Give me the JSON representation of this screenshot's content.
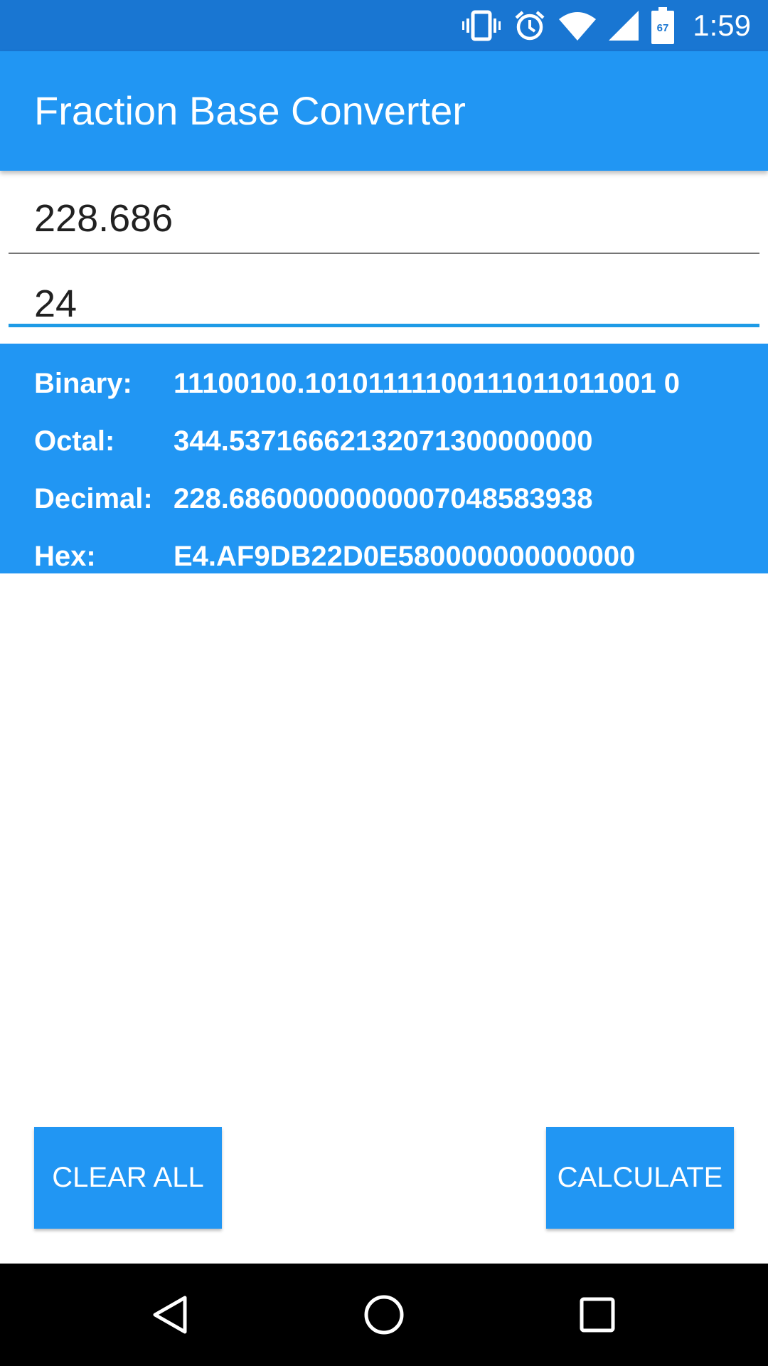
{
  "status_bar": {
    "time": "1:59",
    "icons": [
      "vibrate-icon",
      "alarm-icon",
      "wifi-icon",
      "cellular-signal-icon",
      "battery-icon"
    ],
    "battery_level": "67"
  },
  "app_bar": {
    "title": "Fraction Base Converter"
  },
  "inputs": {
    "number_value": "228.686",
    "base_value": "24"
  },
  "results": [
    {
      "label": "Binary:",
      "value": "11100100.10101111100111011011001 0"
    },
    {
      "label": "Octal:",
      "value": "344.53716662132071300000000"
    },
    {
      "label": "Decimal:",
      "value": "228.68600000000007048583938"
    },
    {
      "label": "Hex:",
      "value": "E4.AF9DB22D0E580000000000000"
    }
  ],
  "buttons": {
    "clear_label": "CLEAR ALL",
    "calculate_label": "CALCULATE"
  },
  "nav_bar": {
    "icons": [
      "back-icon",
      "home-icon",
      "recents-icon"
    ]
  },
  "colors": {
    "status_bar": "#1976D2",
    "primary": "#2196F3",
    "focus_underline": "#1E9BE6"
  }
}
